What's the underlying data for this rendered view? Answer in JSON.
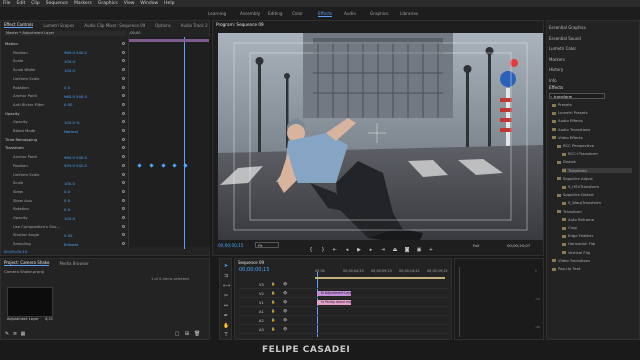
{
  "menubar": [
    "File",
    "Edit",
    "Clip",
    "Sequence",
    "Markers",
    "Graphics",
    "View",
    "Window",
    "Help"
  ],
  "workspaces": [
    {
      "label": "Learning",
      "active": false
    },
    {
      "label": "Assembly",
      "active": false
    },
    {
      "label": "Editing",
      "active": false
    },
    {
      "label": "Color",
      "active": false
    },
    {
      "label": "Effects",
      "active": true
    },
    {
      "label": "Audio",
      "active": false
    },
    {
      "label": "Graphics",
      "active": false
    },
    {
      "label": "Libraries",
      "active": false
    }
  ],
  "effect_controls": {
    "tabs": [
      "Effect Controls",
      "Lumetri Scopes",
      "Audio Clip Mixer: Sequence 09",
      "Options",
      "Audio Track 2"
    ],
    "source": "Master * Adjustment Layer",
    "seq": "Sequence 09 * Adjustment Layer",
    "timecode_top": ";00;00",
    "timecode_kf": "00;00;00;15",
    "sections": [
      {
        "label": "Motion",
        "y": 0
      },
      {
        "label": "Position",
        "value": "960.0   540.0"
      },
      {
        "label": "Scale",
        "value": "100.0"
      },
      {
        "label": "Scale Width",
        "value": "100.0"
      },
      {
        "label": "Uniform Scale",
        "value": ""
      },
      {
        "label": "Rotation",
        "value": "0.0"
      },
      {
        "label": "Anchor Point",
        "value": "960.0   540.0"
      },
      {
        "label": "Anti-flicker Filter",
        "value": "0.00"
      },
      {
        "label": "Opacity",
        "value": ""
      },
      {
        "label": "Opacity",
        "value": "100.0 %"
      },
      {
        "label": "Blend Mode",
        "value": "Normal"
      },
      {
        "label": "Time Remapping",
        "value": ""
      },
      {
        "label": "Transform",
        "value": ""
      },
      {
        "label": "Anchor Point",
        "value": "960.0   540.0"
      },
      {
        "label": "Position",
        "value": "955.0   542.0"
      },
      {
        "label": "Uniform Scale",
        "value": ""
      },
      {
        "label": "Scale",
        "value": "100.0"
      },
      {
        "label": "Skew",
        "value": "0.0"
      },
      {
        "label": "Skew Axis",
        "value": "0.0"
      },
      {
        "label": "Rotation",
        "value": "0.0"
      },
      {
        "label": "Opacity",
        "value": "100.0"
      },
      {
        "label": "Use Composition's Shu...",
        "value": ""
      },
      {
        "label": "Shutter Angle",
        "value": "0.00"
      },
      {
        "label": "Sampling",
        "value": "Bilinear"
      }
    ],
    "bottom_time": "00;00;00;15"
  },
  "program": {
    "title": "Program: Sequence 09",
    "timecode": "00;00;00;15",
    "fit": "Fit",
    "quality": "Full",
    "duration": "00;00;20;07"
  },
  "project": {
    "tabs": [
      "Project: Camera Shake",
      "Media Browser"
    ],
    "file": "Camera Shake.prproj",
    "selected": "1 of 5 items selected",
    "item_label": "Adjustment Layer",
    "item_duration": "4;21"
  },
  "timeline": {
    "tab": "Sequence 09",
    "timecode": "00;00;00;15",
    "ruler": [
      "00;00",
      "00;00;04;23",
      "00;00;09;23",
      "00;00;14;22",
      "00;00;19;22"
    ],
    "tracks": [
      "V3",
      "V2",
      "V1",
      "A1",
      "A2",
      "A3"
    ],
    "clips": [
      {
        "label": "fx Adjustment Layer",
        "track": "V3"
      },
      {
        "label": "fx Pantip drone.mp4",
        "track": "V2"
      }
    ]
  },
  "right_panel": {
    "tops": [
      "Essential Graphics",
      "Essential Sound",
      "Lumetri Color",
      "Markers",
      "History",
      "Info"
    ],
    "effects_title": "Effects",
    "search": "transform",
    "tree": [
      {
        "label": "Presets",
        "indent": 0
      },
      {
        "label": "Lumetri Presets",
        "indent": 0
      },
      {
        "label": "Audio Effects",
        "indent": 0
      },
      {
        "label": "Audio Transitions",
        "indent": 0
      },
      {
        "label": "Video Effects",
        "indent": 0
      },
      {
        "label": "RCC Perspective",
        "indent": 1
      },
      {
        "label": "RCC+Transform",
        "indent": 2
      },
      {
        "label": "Distort",
        "indent": 1
      },
      {
        "label": "Transform",
        "indent": 2,
        "selected": true
      },
      {
        "label": "Sapphire Adjust",
        "indent": 1
      },
      {
        "label": "S_HSVTransform",
        "indent": 2
      },
      {
        "label": "Sapphire Distort",
        "indent": 1
      },
      {
        "label": "S_WarpTransform",
        "indent": 2
      },
      {
        "label": "Transform",
        "indent": 1
      },
      {
        "label": "Auto Reframe",
        "indent": 2
      },
      {
        "label": "Crop",
        "indent": 2
      },
      {
        "label": "Edge Feather",
        "indent": 2
      },
      {
        "label": "Horizontal Flip",
        "indent": 2
      },
      {
        "label": "Vertical Flip",
        "indent": 2
      },
      {
        "label": "Video Transitions",
        "indent": 0
      },
      {
        "label": "Pop-Up Text",
        "indent": 0
      }
    ]
  },
  "watermark": "FELIPE CASADEI",
  "colors": {
    "accent": "#5aa0ff",
    "clip_adjust": "#c08fd6",
    "clip_video": "#e3a3c9"
  }
}
